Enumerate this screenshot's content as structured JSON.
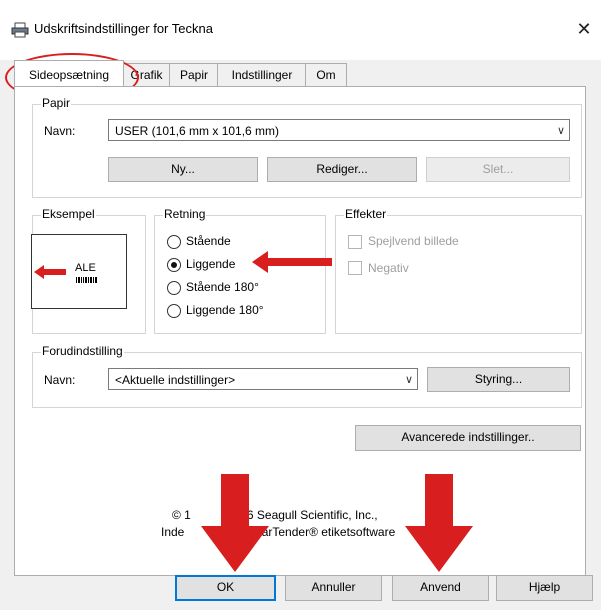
{
  "window": {
    "title": "Udskriftsindstillinger for Teckna",
    "close_glyph": "✕"
  },
  "tabs": [
    {
      "label": "Sideopsætning",
      "active": true
    },
    {
      "label": "Grafik"
    },
    {
      "label": "Papir"
    },
    {
      "label": "Indstillinger"
    },
    {
      "label": "Om"
    }
  ],
  "paper": {
    "group_label": "Papir",
    "name_label": "Navn:",
    "name_value": "USER (101,6 mm x 101,6 mm)",
    "new_button": "Ny...",
    "edit_button": "Rediger...",
    "delete_button": "Slet..."
  },
  "example": {
    "group_label": "Eksempel",
    "preview_text": "ALE"
  },
  "orientation": {
    "group_label": "Retning",
    "options": [
      "Stående",
      "Liggende",
      "Stående 180°",
      "Liggende 180°"
    ],
    "selected": "Liggende"
  },
  "effects": {
    "group_label": "Effekter",
    "mirror_label": "Spejlvend billede",
    "negative_label": "Negativ"
  },
  "preset": {
    "group_label": "Forudindstilling",
    "name_label": "Navn:",
    "name_value": "<Aktuelle indstillinger>",
    "manage_button": "Styring..."
  },
  "advanced_button": "Avancerede indstillinger..",
  "copyright": {
    "line1_a": "© 1",
    "line1_b": "2016 Seagull Scientific, Inc.,",
    "line2_a": "Inde",
    "line2_b": "af BarTender® etiketsoftware"
  },
  "footer": {
    "ok": "OK",
    "cancel": "Annuller",
    "apply": "Anvend",
    "help": "Hjælp"
  },
  "colors": {
    "annotation_red": "#d81e1e",
    "focus_blue": "#0078d7"
  }
}
